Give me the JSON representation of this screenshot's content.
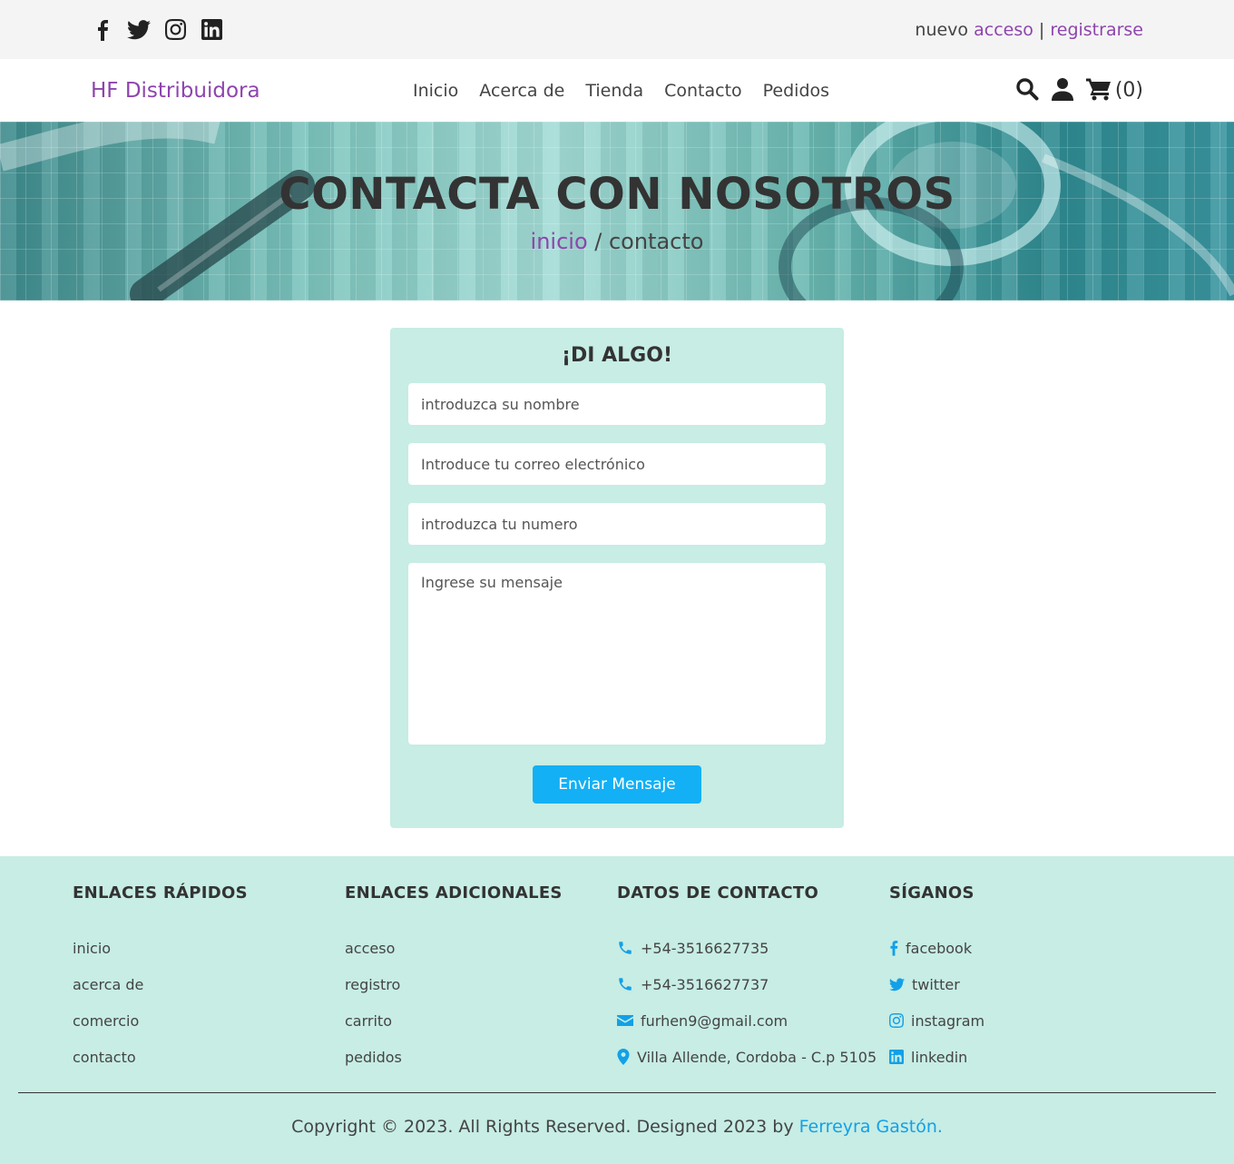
{
  "topbar": {
    "social_icons": [
      "facebook-icon",
      "twitter-icon",
      "instagram-icon",
      "linkedin-icon"
    ],
    "account": {
      "prefix": "nuevo",
      "login": "acceso",
      "separator": "|",
      "register": "registrarse"
    }
  },
  "header": {
    "logo": "HF Distribuidora",
    "nav": [
      "Inicio",
      "Acerca de",
      "Tienda",
      "Contacto",
      "Pedidos"
    ],
    "cart_count": "(0)"
  },
  "banner": {
    "title": "CONTACTA CON NOSOTROS",
    "crumb_home": "inicio",
    "crumb_sep": " / ",
    "crumb_current": "contacto"
  },
  "form": {
    "heading": "¡DI ALGO!",
    "name_placeholder": "introduzca su nombre",
    "email_placeholder": "Introduce tu correo electrónico",
    "number_placeholder": "introduzca tu numero",
    "message_placeholder": "Ingrese su mensaje",
    "submit": "Enviar Mensaje"
  },
  "footer": {
    "quick": {
      "title": "ENLACES RÁPIDOS",
      "items": [
        "inicio",
        "acerca de",
        "comercio",
        "contacto"
      ]
    },
    "extra": {
      "title": "ENLACES ADICIONALES",
      "items": [
        "acceso",
        "registro",
        "carrito",
        "pedidos"
      ]
    },
    "contact": {
      "title": "DATOS DE CONTACTO",
      "phone1": "+54-3516627735",
      "phone2": "+54-3516627737",
      "email": "furhen9@gmail.com",
      "address": "Villa Allende, Cordoba - C.p 5105"
    },
    "follow": {
      "title": "SÍGANOS",
      "items": [
        "facebook",
        "twitter",
        "instagram",
        "linkedin"
      ]
    },
    "copyright": "Copyright © 2023. All Rights Reserved. Designed 2023 by ",
    "author": "Ferreyra Gastón."
  },
  "colors": {
    "accent_purple": "#8e44ad",
    "accent_blue": "#13b0f5",
    "mint": "#c7ede4"
  }
}
